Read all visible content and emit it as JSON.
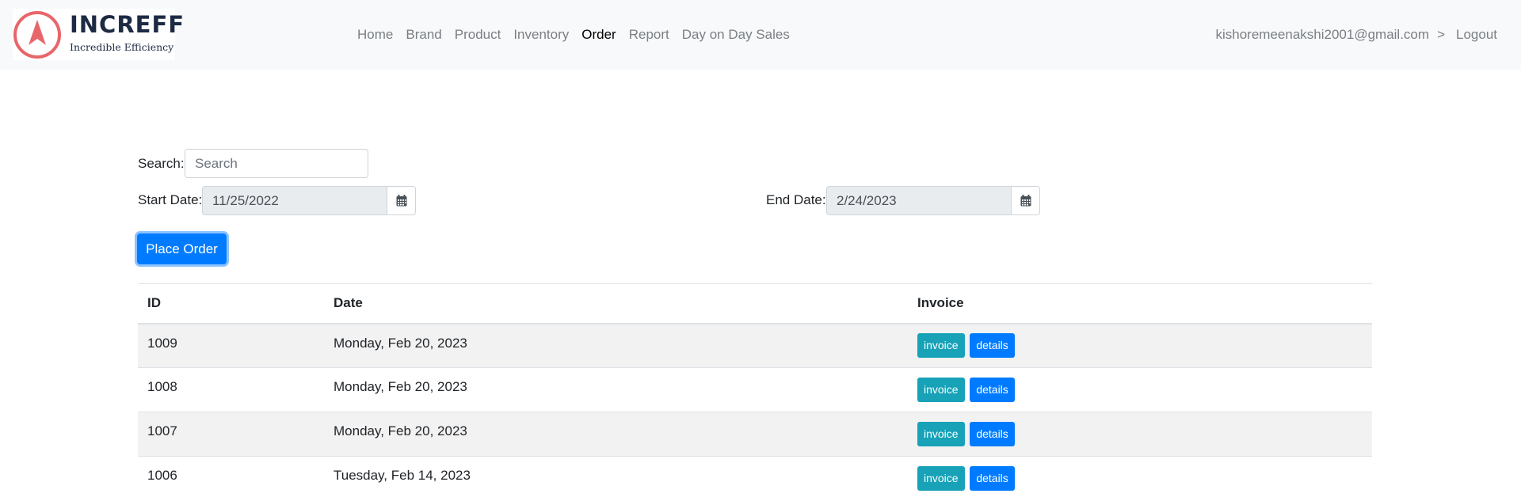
{
  "brand": {
    "name": "INCREFF",
    "tagline": "Incredible Efficiency",
    "colors": {
      "ring": "#e8666a",
      "text": "#1d2a44"
    }
  },
  "nav": {
    "links": [
      {
        "label": "Home"
      },
      {
        "label": "Brand"
      },
      {
        "label": "Product"
      },
      {
        "label": "Inventory"
      },
      {
        "label": "Order",
        "active": true
      },
      {
        "label": "Report"
      },
      {
        "label": "Day on Day Sales"
      }
    ],
    "user_email": "kishoremeenakshi2001@gmail.com",
    "separator": ">",
    "logout_label": "Logout"
  },
  "filters": {
    "search_label": "Search:",
    "search_placeholder": "Search",
    "start_label": "Start Date:",
    "start_value": "11/25/2022",
    "end_label": "End Date:",
    "end_value": "2/24/2023",
    "calendar_icon": "calendar-icon"
  },
  "actions": {
    "place_order_label": "Place Order"
  },
  "table": {
    "headers": {
      "id": "ID",
      "date": "Date",
      "invoice": "Invoice"
    },
    "rows": [
      {
        "id": "1009",
        "date": "Monday, Feb 20, 2023",
        "invoice_label": "invoice",
        "details_label": "details"
      },
      {
        "id": "1008",
        "date": "Monday, Feb 20, 2023",
        "invoice_label": "invoice",
        "details_label": "details"
      },
      {
        "id": "1007",
        "date": "Monday, Feb 20, 2023",
        "invoice_label": "invoice",
        "details_label": "details"
      },
      {
        "id": "1006",
        "date": "Tuesday, Feb 14, 2023",
        "invoice_label": "invoice",
        "details_label": "details"
      }
    ]
  },
  "colors": {
    "primary": "#007bff",
    "info": "#17a2b8",
    "navbar_bg": "#f8f9fa"
  }
}
